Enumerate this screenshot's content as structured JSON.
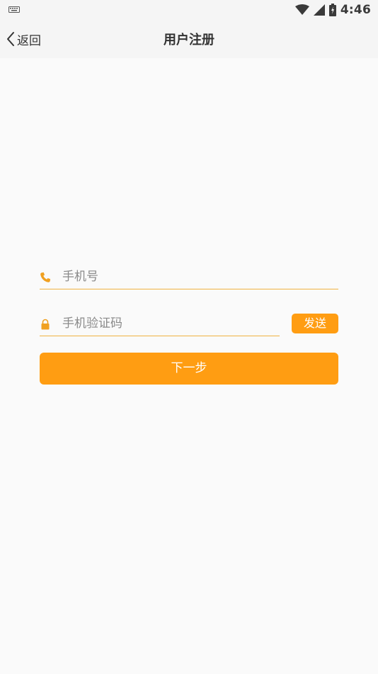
{
  "status_bar": {
    "time": "4:46"
  },
  "nav": {
    "back_label": "返回",
    "title": "用户注册"
  },
  "form": {
    "phone_placeholder": "手机号",
    "code_placeholder": "手机验证码",
    "send_label": "发送",
    "next_label": "下一步"
  },
  "colors": {
    "accent": "#ff9d12",
    "underline": "#f0b341",
    "icon": "#f0a020"
  }
}
